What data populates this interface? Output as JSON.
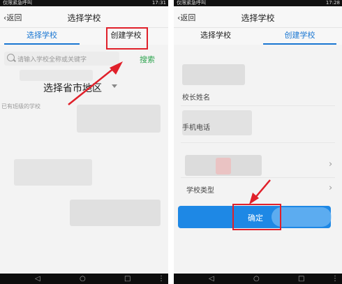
{
  "status": {
    "carrier": "仅限紧急呼叫",
    "time_left": "17:31",
    "time_right": "17:28"
  },
  "navbar": {
    "back_label": "返回",
    "title": "选择学校"
  },
  "tabs": {
    "select_school": "选择学校",
    "create_school": "创建学校"
  },
  "search": {
    "placeholder": "请输入学校全称或关键字",
    "button_label": "搜索"
  },
  "region": {
    "label": "选择省市地区"
  },
  "section": {
    "existing_label": "已有班级的学校"
  },
  "form": {
    "principal_name": "校长姓名",
    "phone": "手机电话",
    "school_type": "学校类型"
  },
  "confirm": {
    "label": "确定"
  },
  "icons": {
    "back": "chevron-left-icon",
    "search": "search-icon",
    "nav_back": "triangle-back-icon",
    "nav_home": "circle-home-icon",
    "nav_recent": "square-recent-icon",
    "nav_menu": "dots-menu-icon"
  },
  "colors": {
    "accent": "#1976d2",
    "search_green": "#2ea44f",
    "highlight_red": "#e0202a",
    "confirm_blue": "#1e88e5"
  }
}
